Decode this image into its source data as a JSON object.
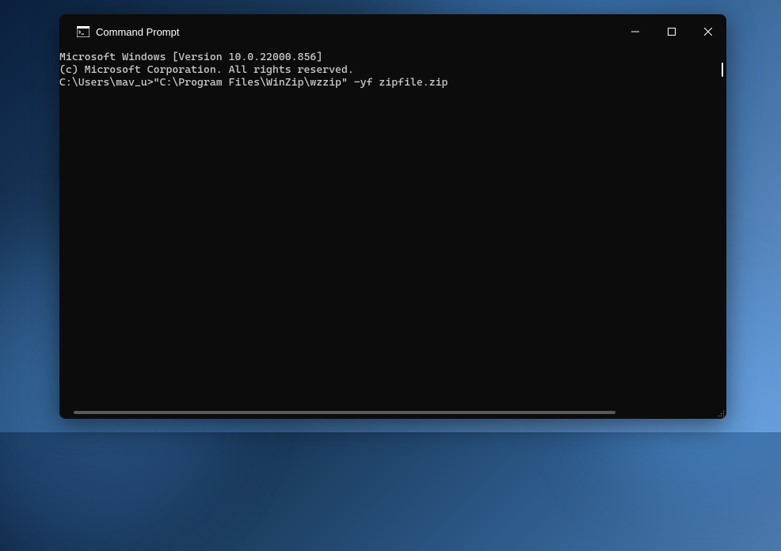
{
  "window": {
    "title": "Command Prompt"
  },
  "terminal": {
    "line1": "Microsoft Windows [Version 10.0.22000.856]",
    "line2": "(c) Microsoft Corporation. All rights reserved.",
    "blank": "",
    "prompt": "C:\\Users\\mav_u>",
    "command": "\"C:\\Program Files\\WinZip\\wzzip\" -yf zipfile.zip"
  }
}
